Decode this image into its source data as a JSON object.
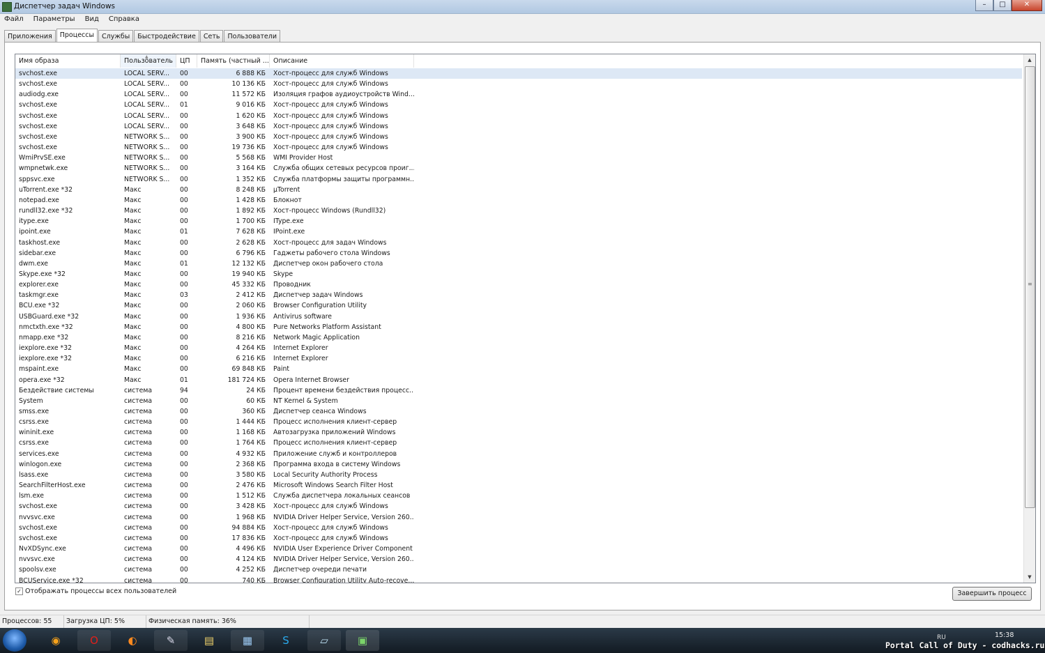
{
  "window": {
    "title": "Диспетчер задач Windows",
    "btn_min": "–",
    "btn_max": "□",
    "btn_close": "✕"
  },
  "menu": [
    "Файл",
    "Параметры",
    "Вид",
    "Справка"
  ],
  "tabs": [
    "Приложения",
    "Процессы",
    "Службы",
    "Быстродействие",
    "Сеть",
    "Пользователи"
  ],
  "columns": [
    "Имя образа",
    "Пользователь",
    "ЦП",
    "Память (частный ...",
    "Описание"
  ],
  "rows": [
    [
      "svchost.exe",
      "LOCAL SERV...",
      "00",
      "6 888 КБ",
      "Хост-процесс для служб Windows"
    ],
    [
      "svchost.exe",
      "LOCAL SERV...",
      "00",
      "10 136 КБ",
      "Хост-процесс для служб Windows"
    ],
    [
      "audiodg.exe",
      "LOCAL SERV...",
      "00",
      "11 572 КБ",
      "Изоляция графов аудиоустройств Wind..."
    ],
    [
      "svchost.exe",
      "LOCAL SERV...",
      "01",
      "9 016 КБ",
      "Хост-процесс для служб Windows"
    ],
    [
      "svchost.exe",
      "LOCAL SERV...",
      "00",
      "1 620 КБ",
      "Хост-процесс для служб Windows"
    ],
    [
      "svchost.exe",
      "LOCAL SERV...",
      "00",
      "3 648 КБ",
      "Хост-процесс для служб Windows"
    ],
    [
      "svchost.exe",
      "NETWORK S...",
      "00",
      "3 900 КБ",
      "Хост-процесс для служб Windows"
    ],
    [
      "svchost.exe",
      "NETWORK S...",
      "00",
      "19 736 КБ",
      "Хост-процесс для служб Windows"
    ],
    [
      "WmiPrvSE.exe",
      "NETWORK S...",
      "00",
      "5 568 КБ",
      "WMI Provider Host"
    ],
    [
      "wmpnetwk.exe",
      "NETWORK S...",
      "00",
      "3 164 КБ",
      "Служба общих сетевых ресурсов проиг..."
    ],
    [
      "sppsvc.exe",
      "NETWORK S...",
      "00",
      "1 352 КБ",
      "Служба платформы защиты программн..."
    ],
    [
      "uTorrent.exe *32",
      "Макс",
      "00",
      "8 248 КБ",
      "µTorrent"
    ],
    [
      "notepad.exe",
      "Макс",
      "00",
      "1 428 КБ",
      "Блокнот"
    ],
    [
      "rundll32.exe *32",
      "Макс",
      "00",
      "1 892 КБ",
      "Хост-процесс Windows (Rundll32)"
    ],
    [
      "itype.exe",
      "Макс",
      "00",
      "1 700 КБ",
      "IType.exe"
    ],
    [
      "ipoint.exe",
      "Макс",
      "01",
      "7 628 КБ",
      "IPoint.exe"
    ],
    [
      "taskhost.exe",
      "Макс",
      "00",
      "2 628 КБ",
      "Хост-процесс для задач Windows"
    ],
    [
      "sidebar.exe",
      "Макс",
      "00",
      "6 796 КБ",
      "Гаджеты рабочего стола Windows"
    ],
    [
      "dwm.exe",
      "Макс",
      "01",
      "12 132 КБ",
      "Диспетчер окон рабочего стола"
    ],
    [
      "Skype.exe *32",
      "Макс",
      "00",
      "19 940 КБ",
      "Skype"
    ],
    [
      "explorer.exe",
      "Макс",
      "00",
      "45 332 КБ",
      "Проводник"
    ],
    [
      "taskmgr.exe",
      "Макс",
      "03",
      "2 412 КБ",
      "Диспетчер задач Windows"
    ],
    [
      "BCU.exe *32",
      "Макс",
      "00",
      "2 060 КБ",
      "Browser Configuration Utility"
    ],
    [
      "USBGuard.exe *32",
      "Макс",
      "00",
      "1 936 КБ",
      "Antivirus software"
    ],
    [
      "nmctxth.exe *32",
      "Макс",
      "00",
      "4 800 КБ",
      "Pure Networks Platform Assistant"
    ],
    [
      "nmapp.exe *32",
      "Макс",
      "00",
      "8 216 КБ",
      "Network Magic Application"
    ],
    [
      "iexplore.exe *32",
      "Макс",
      "00",
      "4 264 КБ",
      "Internet Explorer"
    ],
    [
      "iexplore.exe *32",
      "Макс",
      "00",
      "6 216 КБ",
      "Internet Explorer"
    ],
    [
      "mspaint.exe",
      "Макс",
      "00",
      "69 848 КБ",
      "Paint"
    ],
    [
      "opera.exe *32",
      "Макс",
      "01",
      "181 724 КБ",
      "Opera Internet Browser"
    ],
    [
      "Бездействие системы",
      "система",
      "94",
      "24 КБ",
      "Процент времени бездействия процесс..."
    ],
    [
      "System",
      "система",
      "00",
      "60 КБ",
      "NT Kernel & System"
    ],
    [
      "smss.exe",
      "система",
      "00",
      "360 КБ",
      "Диспетчер сеанса  Windows"
    ],
    [
      "csrss.exe",
      "система",
      "00",
      "1 444 КБ",
      "Процесс исполнения клиент-сервер"
    ],
    [
      "wininit.exe",
      "система",
      "00",
      "1 168 КБ",
      "Автозагрузка приложений Windows"
    ],
    [
      "csrss.exe",
      "система",
      "00",
      "1 764 КБ",
      "Процесс исполнения клиент-сервер"
    ],
    [
      "services.exe",
      "система",
      "00",
      "4 932 КБ",
      "Приложение служб и контроллеров"
    ],
    [
      "winlogon.exe",
      "система",
      "00",
      "2 368 КБ",
      "Программа входа в систему Windows"
    ],
    [
      "lsass.exe",
      "система",
      "00",
      "3 580 КБ",
      "Local Security Authority Process"
    ],
    [
      "SearchFilterHost.exe",
      "система",
      "00",
      "2 476 КБ",
      "Microsoft Windows Search Filter Host"
    ],
    [
      "lsm.exe",
      "система",
      "00",
      "1 512 КБ",
      "Служба диспетчера локальных сеансов"
    ],
    [
      "svchost.exe",
      "система",
      "00",
      "3 428 КБ",
      "Хост-процесс для служб Windows"
    ],
    [
      "nvvsvc.exe",
      "система",
      "00",
      "1 968 КБ",
      "NVIDIA Driver Helper Service, Version 260..."
    ],
    [
      "svchost.exe",
      "система",
      "00",
      "94 884 КБ",
      "Хост-процесс для служб Windows"
    ],
    [
      "svchost.exe",
      "система",
      "00",
      "17 836 КБ",
      "Хост-процесс для служб Windows"
    ],
    [
      "NvXDSync.exe",
      "система",
      "00",
      "4 496 КБ",
      "NVIDIA User Experience Driver Component"
    ],
    [
      "nvvsvc.exe",
      "система",
      "00",
      "4 124 КБ",
      "NVIDIA Driver Helper Service, Version 260..."
    ],
    [
      "spoolsv.exe",
      "система",
      "00",
      "4 252 КБ",
      "Диспетчер очереди печати"
    ],
    [
      "BCUService.exe *32",
      "система",
      "00",
      "740 КБ",
      "Browser Configuration Utility Auto-recove..."
    ]
  ],
  "show_all_label": "Отображать процессы всех пользователей",
  "show_all_checked": true,
  "end_process_label": "Завершить процесс",
  "status": {
    "processes": "Процессов: 55",
    "cpu": "Загрузка ЦП: 5%",
    "memory": "Физическая память: 36%"
  },
  "tray": {
    "lang": "RU",
    "time": "15:38"
  },
  "watermark": "Portal Call of Duty - codhacks.ru",
  "taskbar_icons": [
    "player-icon",
    "opera-icon",
    "firefox-icon",
    "paint-icon",
    "explorer-icon",
    "network-icon",
    "skype-icon",
    "notepad-icon",
    "taskmgr-icon"
  ]
}
